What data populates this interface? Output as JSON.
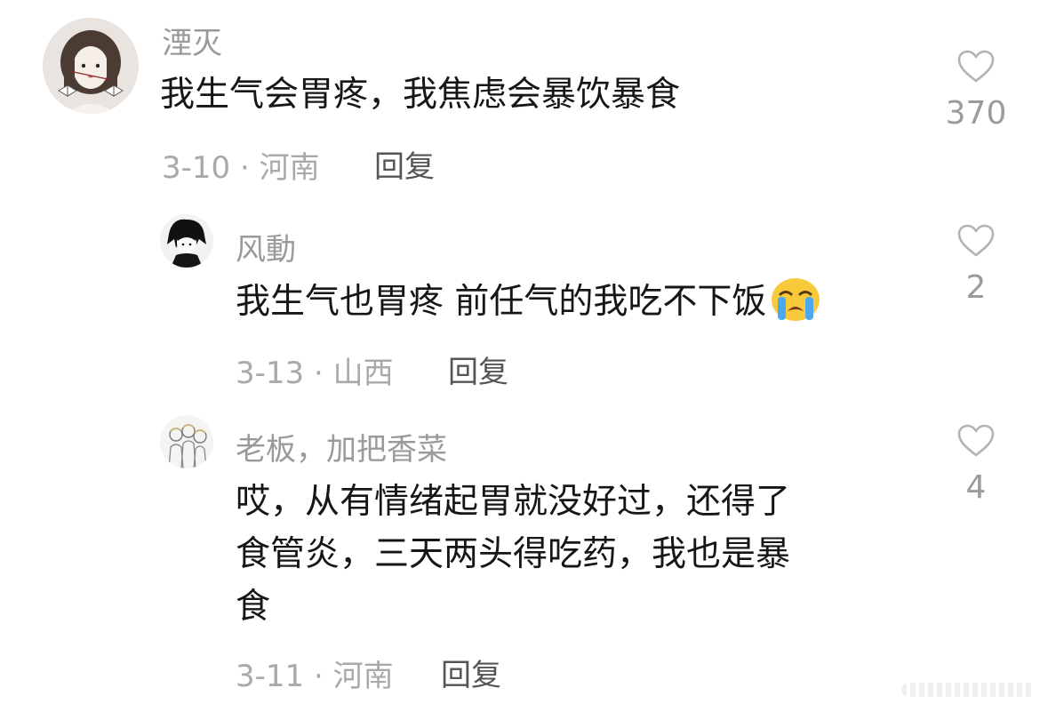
{
  "comments": [
    {
      "username": "湮灭",
      "text": "我生气会胃疼，我焦虑会暴饮暴食",
      "meta": "3-10 · 河南",
      "reply_label": "回复",
      "likes": "370",
      "avatar_icon": "avatar-girl-portrait"
    }
  ],
  "replies": [
    {
      "username": "风動",
      "text": "我生气也胃疼 前任气的我吃不下饭",
      "emoji": "loudly-crying-face-emoji",
      "meta": "3-13 · 山西",
      "reply_label": "回复",
      "likes": "2",
      "avatar_icon": "avatar-dark-sketch"
    },
    {
      "username": "老板，加把香菜",
      "text_lines": [
        "哎，从有情绪起胃就没好过，还得了",
        "食管炎，三天两头得吃药，我也是暴",
        "食"
      ],
      "meta": "3-11 · 河南",
      "reply_label": "回复",
      "likes": "4",
      "avatar_icon": "avatar-sketch-group"
    }
  ],
  "colors": {
    "username": "#9a9a9a",
    "text": "#161616",
    "meta": "#a9a9a9",
    "reply": "#555555",
    "like_icon": "#b3b3b3"
  }
}
